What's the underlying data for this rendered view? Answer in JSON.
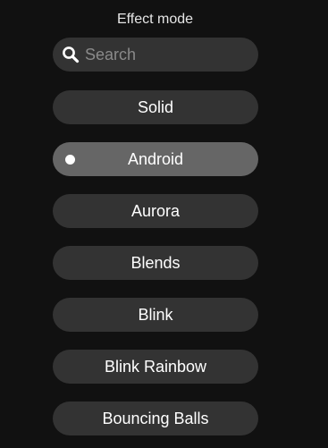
{
  "panel": {
    "title": "Effect mode"
  },
  "search": {
    "placeholder": "Search",
    "value": "",
    "icon": "search-icon"
  },
  "effects": {
    "selected": "Android",
    "items": [
      {
        "label": "Solid"
      },
      {
        "label": "Android"
      },
      {
        "label": "Aurora"
      },
      {
        "label": "Blends"
      },
      {
        "label": "Blink"
      },
      {
        "label": "Blink Rainbow"
      },
      {
        "label": "Bouncing Balls"
      }
    ]
  },
  "colors": {
    "background": "#111111",
    "item": "#333333",
    "item_selected": "#666666",
    "text": "#ffffff"
  }
}
